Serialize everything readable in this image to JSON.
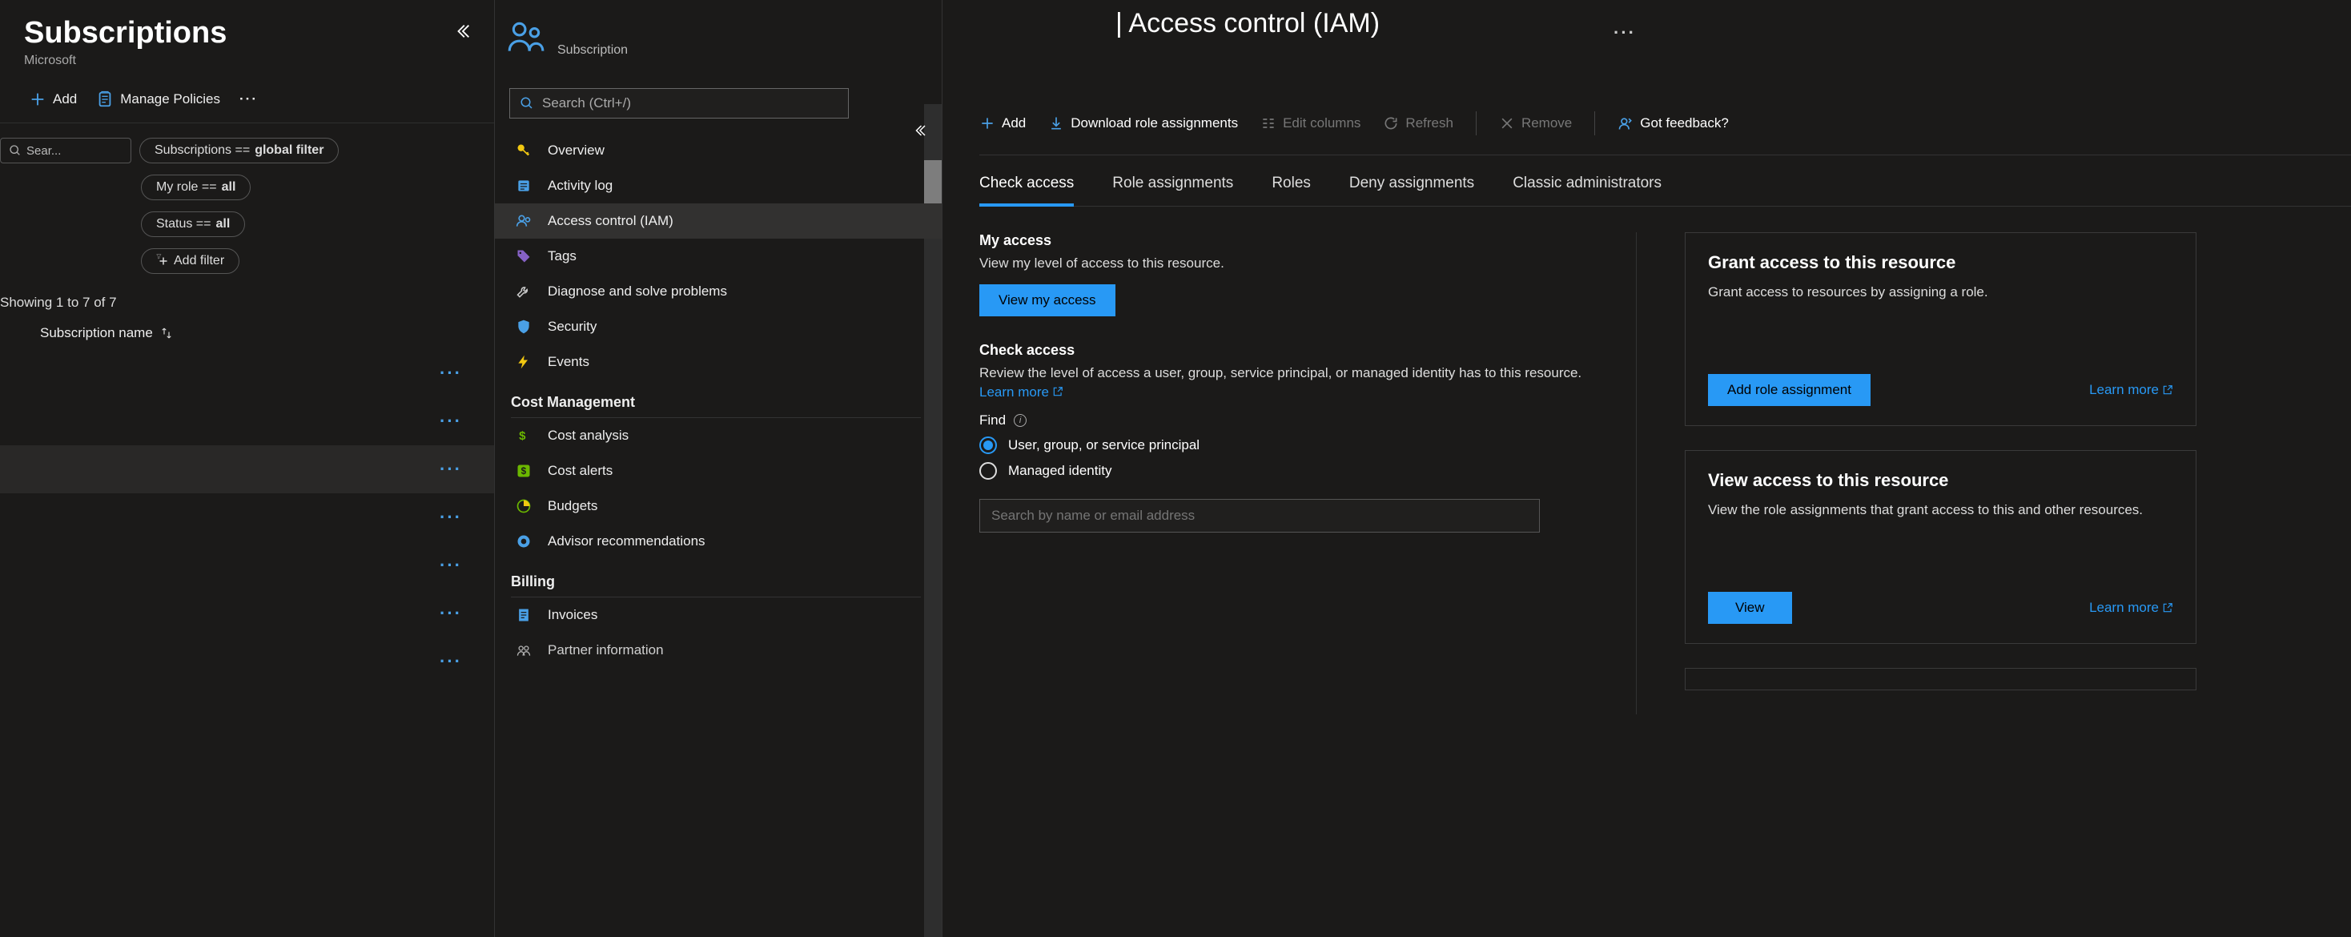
{
  "left": {
    "title": "Subscriptions",
    "subtitle": "Microsoft",
    "add": "Add",
    "manage_policies": "Manage Policies",
    "search_placeholder": "Sear...",
    "filter_subscriptions_prefix": "Subscriptions == ",
    "filter_subscriptions_value": "global filter",
    "filter_role_prefix": "My role == ",
    "filter_role_value": "all",
    "filter_status_prefix": "Status == ",
    "filter_status_value": "all",
    "add_filter": "Add filter",
    "results": "Showing 1 to 7 of 7",
    "column_header": "Subscription name"
  },
  "mid": {
    "subtitle": "Subscription",
    "search_placeholder": "Search (Ctrl+/)",
    "nav": {
      "overview": "Overview",
      "activity": "Activity log",
      "iam": "Access control (IAM)",
      "tags": "Tags",
      "diagnose": "Diagnose and solve problems",
      "security": "Security",
      "events": "Events",
      "group_cost": "Cost Management",
      "cost_analysis": "Cost analysis",
      "cost_alerts": "Cost alerts",
      "budgets": "Budgets",
      "advisor": "Advisor recommendations",
      "group_billing": "Billing",
      "invoices": "Invoices",
      "partner": "Partner information"
    }
  },
  "right": {
    "title": "| Access control (IAM)",
    "toolbar": {
      "add": "Add",
      "download": "Download role assignments",
      "edit_columns": "Edit columns",
      "refresh": "Refresh",
      "remove": "Remove",
      "feedback": "Got feedback?"
    },
    "tabs": {
      "check": "Check access",
      "roles_assign": "Role assignments",
      "roles": "Roles",
      "deny": "Deny assignments",
      "classic": "Classic administrators"
    },
    "my_access_title": "My access",
    "my_access_text": "View my level of access to this resource.",
    "view_my_access_btn": "View my access",
    "check_access_title": "Check access",
    "check_access_text": "Review the level of access a user, group, service principal, or managed identity has to this resource. ",
    "learn_more": "Learn more",
    "find_label": "Find",
    "radio_user": "User, group, or service principal",
    "radio_managed": "Managed identity",
    "search_placeholder": "Search by name or email address",
    "card1_title": "Grant access to this resource",
    "card1_text": "Grant access to resources by assigning a role.",
    "card1_btn": "Add role assignment",
    "card2_title": "View access to this resource",
    "card2_text": "View the role assignments that grant access to this and other resources.",
    "card2_btn": "View"
  }
}
